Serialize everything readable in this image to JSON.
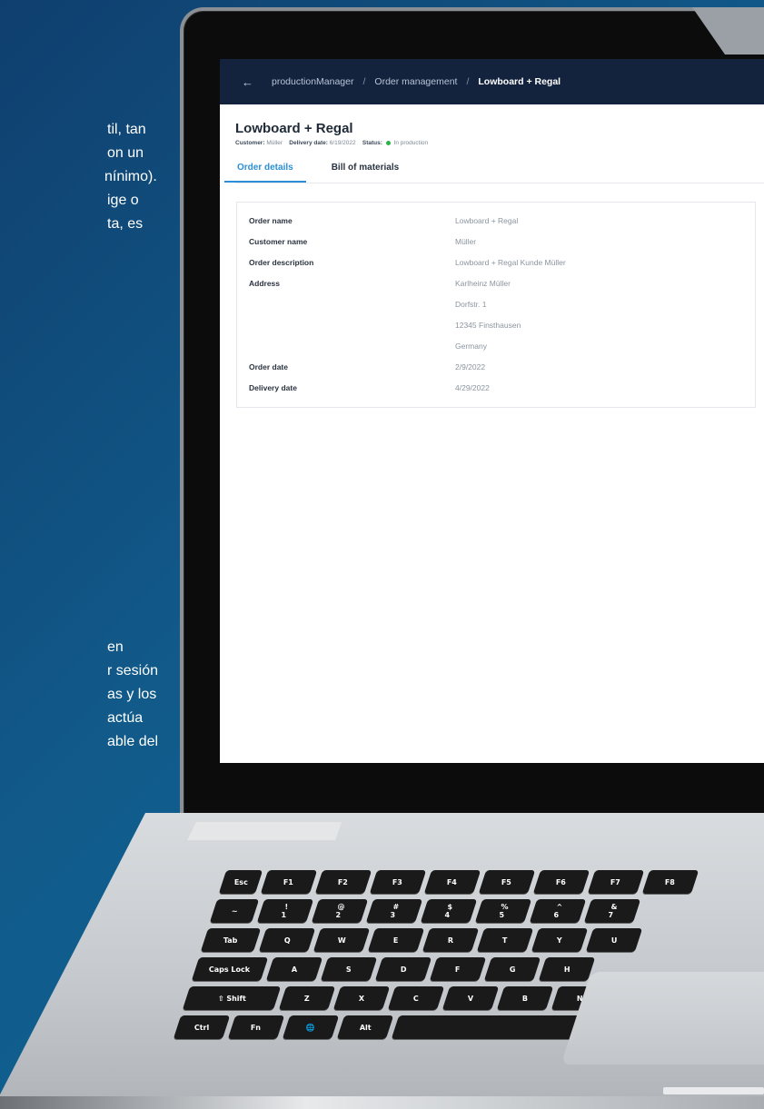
{
  "side_text": {
    "block1": [
      "til, tan",
      "on un",
      "nínimo).",
      "ige o",
      "",
      "ta, es"
    ],
    "block2": [
      "en",
      "r sesión",
      "as y los",
      "actúa",
      "able del"
    ]
  },
  "app": {
    "breadcrumb": {
      "back_icon": "←",
      "items": [
        "productionManager",
        "Order management"
      ],
      "separator": "/",
      "current": "Lowboard + Regal"
    },
    "page_title": "Lowboard + Regal",
    "meta": {
      "customer_label": "Customer:",
      "customer_value": "Müller",
      "delivery_label": "Delivery date:",
      "delivery_value": "6/19/2022",
      "status_label": "Status:",
      "status_value": "In production",
      "status_color": "#2bb24c"
    },
    "tabs": [
      {
        "label": "Order details",
        "active": true
      },
      {
        "label": "Bill of materials",
        "active": false
      }
    ],
    "details": [
      {
        "label": "Order name",
        "value": "Lowboard + Regal"
      },
      {
        "label": "Customer name",
        "value": "Müller"
      },
      {
        "label": "Order description",
        "value": "Lowboard + Regal Kunde Müller"
      },
      {
        "label": "Address",
        "value": "Karlheinz Müller"
      },
      {
        "label": "",
        "value": "Dorfstr. 1"
      },
      {
        "label": "",
        "value": "12345 Finsthausen"
      },
      {
        "label": "",
        "value": "Germany"
      },
      {
        "label": "Order date",
        "value": "2/9/2022"
      },
      {
        "label": "Delivery date",
        "value": "4/29/2022"
      }
    ]
  },
  "keyboard": {
    "row1": [
      "Esc",
      "F1",
      "F2",
      "F3",
      "F4",
      "F5",
      "F6",
      "F7",
      "F8"
    ],
    "row2": [
      [
        "~",
        "`"
      ],
      [
        "!",
        "1"
      ],
      [
        "@",
        "2"
      ],
      [
        "#",
        "3"
      ],
      [
        "$",
        "4"
      ],
      [
        "%",
        "5"
      ],
      [
        "^",
        "6"
      ],
      [
        "&",
        "7"
      ]
    ],
    "row3": [
      "Tab",
      "Q",
      "W",
      "E",
      "R",
      "T",
      "Y",
      "U"
    ],
    "row4": [
      "Caps Lock",
      "A",
      "S",
      "D",
      "F",
      "G",
      "H"
    ],
    "row5": [
      "⇧ Shift",
      "Z",
      "X",
      "C",
      "V",
      "B",
      "N"
    ],
    "row6": [
      "Ctrl",
      "Fn",
      "🌐",
      "Alt",
      ""
    ]
  }
}
